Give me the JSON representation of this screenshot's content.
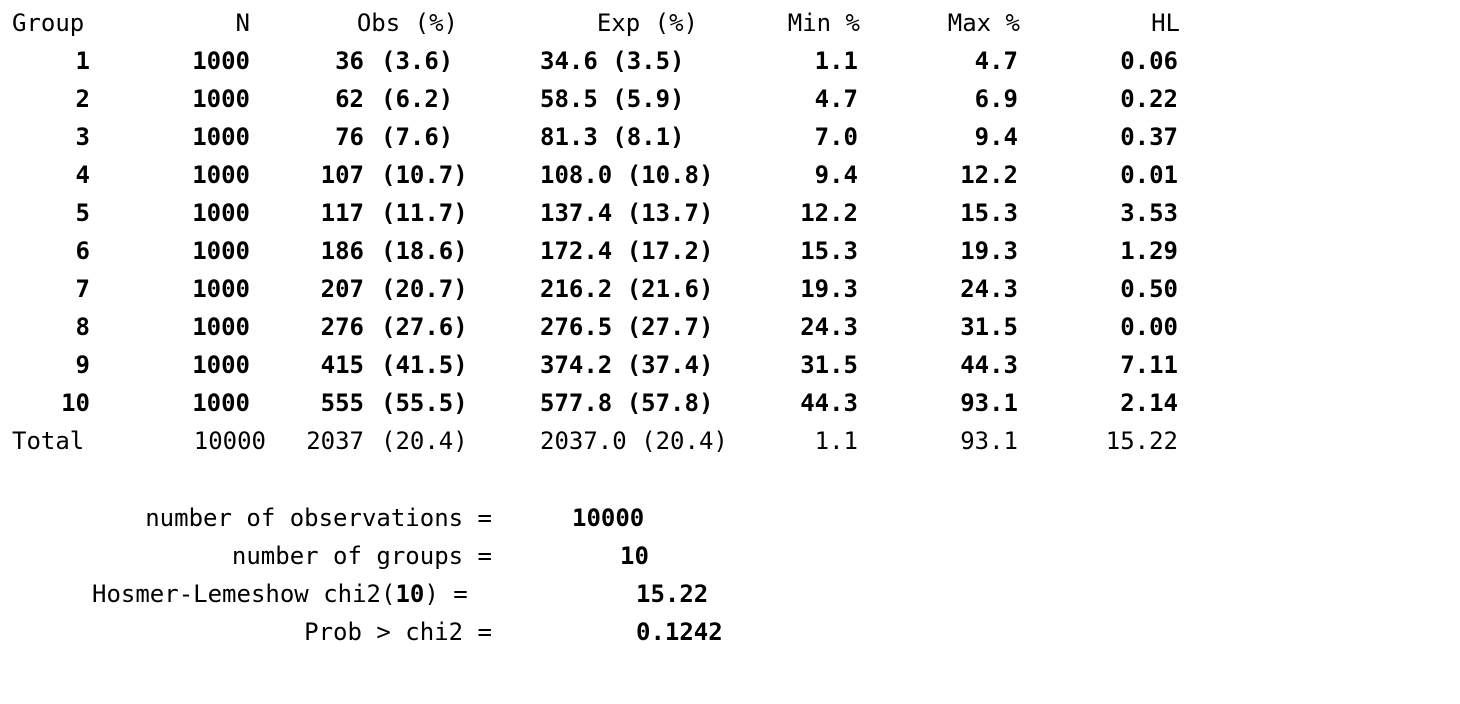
{
  "table": {
    "headers": [
      "Group",
      "N",
      "Obs (%)",
      "Exp (%)",
      "Min %",
      "Max %",
      "HL"
    ],
    "rows": [
      {
        "group": "1",
        "n": "1000",
        "obs": "36 (3.6)",
        "exp": "34.6 (3.5)",
        "min": "1.1",
        "max": "4.7",
        "hl": "0.06"
      },
      {
        "group": "2",
        "n": "1000",
        "obs": "62 (6.2)",
        "exp": "58.5 (5.9)",
        "min": "4.7",
        "max": "6.9",
        "hl": "0.22"
      },
      {
        "group": "3",
        "n": "1000",
        "obs": "76 (7.6)",
        "exp": "81.3 (8.1)",
        "min": "7.0",
        "max": "9.4",
        "hl": "0.37"
      },
      {
        "group": "4",
        "n": "1000",
        "obs": "107 (10.7)",
        "exp": "108.0 (10.8)",
        "min": "9.4",
        "max": "12.2",
        "hl": "0.01"
      },
      {
        "group": "5",
        "n": "1000",
        "obs": "117 (11.7)",
        "exp": "137.4 (13.7)",
        "min": "12.2",
        "max": "15.3",
        "hl": "3.53"
      },
      {
        "group": "6",
        "n": "1000",
        "obs": "186 (18.6)",
        "exp": "172.4 (17.2)",
        "min": "15.3",
        "max": "19.3",
        "hl": "1.29"
      },
      {
        "group": "7",
        "n": "1000",
        "obs": "207 (20.7)",
        "exp": "216.2 (21.6)",
        "min": "19.3",
        "max": "24.3",
        "hl": "0.50"
      },
      {
        "group": "8",
        "n": "1000",
        "obs": "276 (27.6)",
        "exp": "276.5 (27.7)",
        "min": "24.3",
        "max": "31.5",
        "hl": "0.00"
      },
      {
        "group": "9",
        "n": "1000",
        "obs": "415 (41.5)",
        "exp": "374.2 (37.4)",
        "min": "31.5",
        "max": "44.3",
        "hl": "7.11"
      },
      {
        "group": "10",
        "n": "1000",
        "obs": "555 (55.5)",
        "exp": "577.8 (57.8)",
        "min": "44.3",
        "max": "93.1",
        "hl": "2.14"
      }
    ],
    "total": {
      "group": "Total",
      "n": "10000",
      "obs": "2037 (20.4)",
      "exp": "2037.0 (20.4)",
      "min": "1.1",
      "max": "93.1",
      "hl": "15.22"
    }
  },
  "summary": {
    "obs_label": "number of observations =",
    "obs_value": "10000",
    "groups_label": "number of groups =",
    "groups_value": "10",
    "hl_label_pre": "Hosmer-Lemeshow chi2(",
    "hl_df": "10",
    "hl_label_post": ") =",
    "hl_value": "15.22",
    "prob_label": "Prob > chi2 =",
    "prob_value": "0.1242"
  }
}
